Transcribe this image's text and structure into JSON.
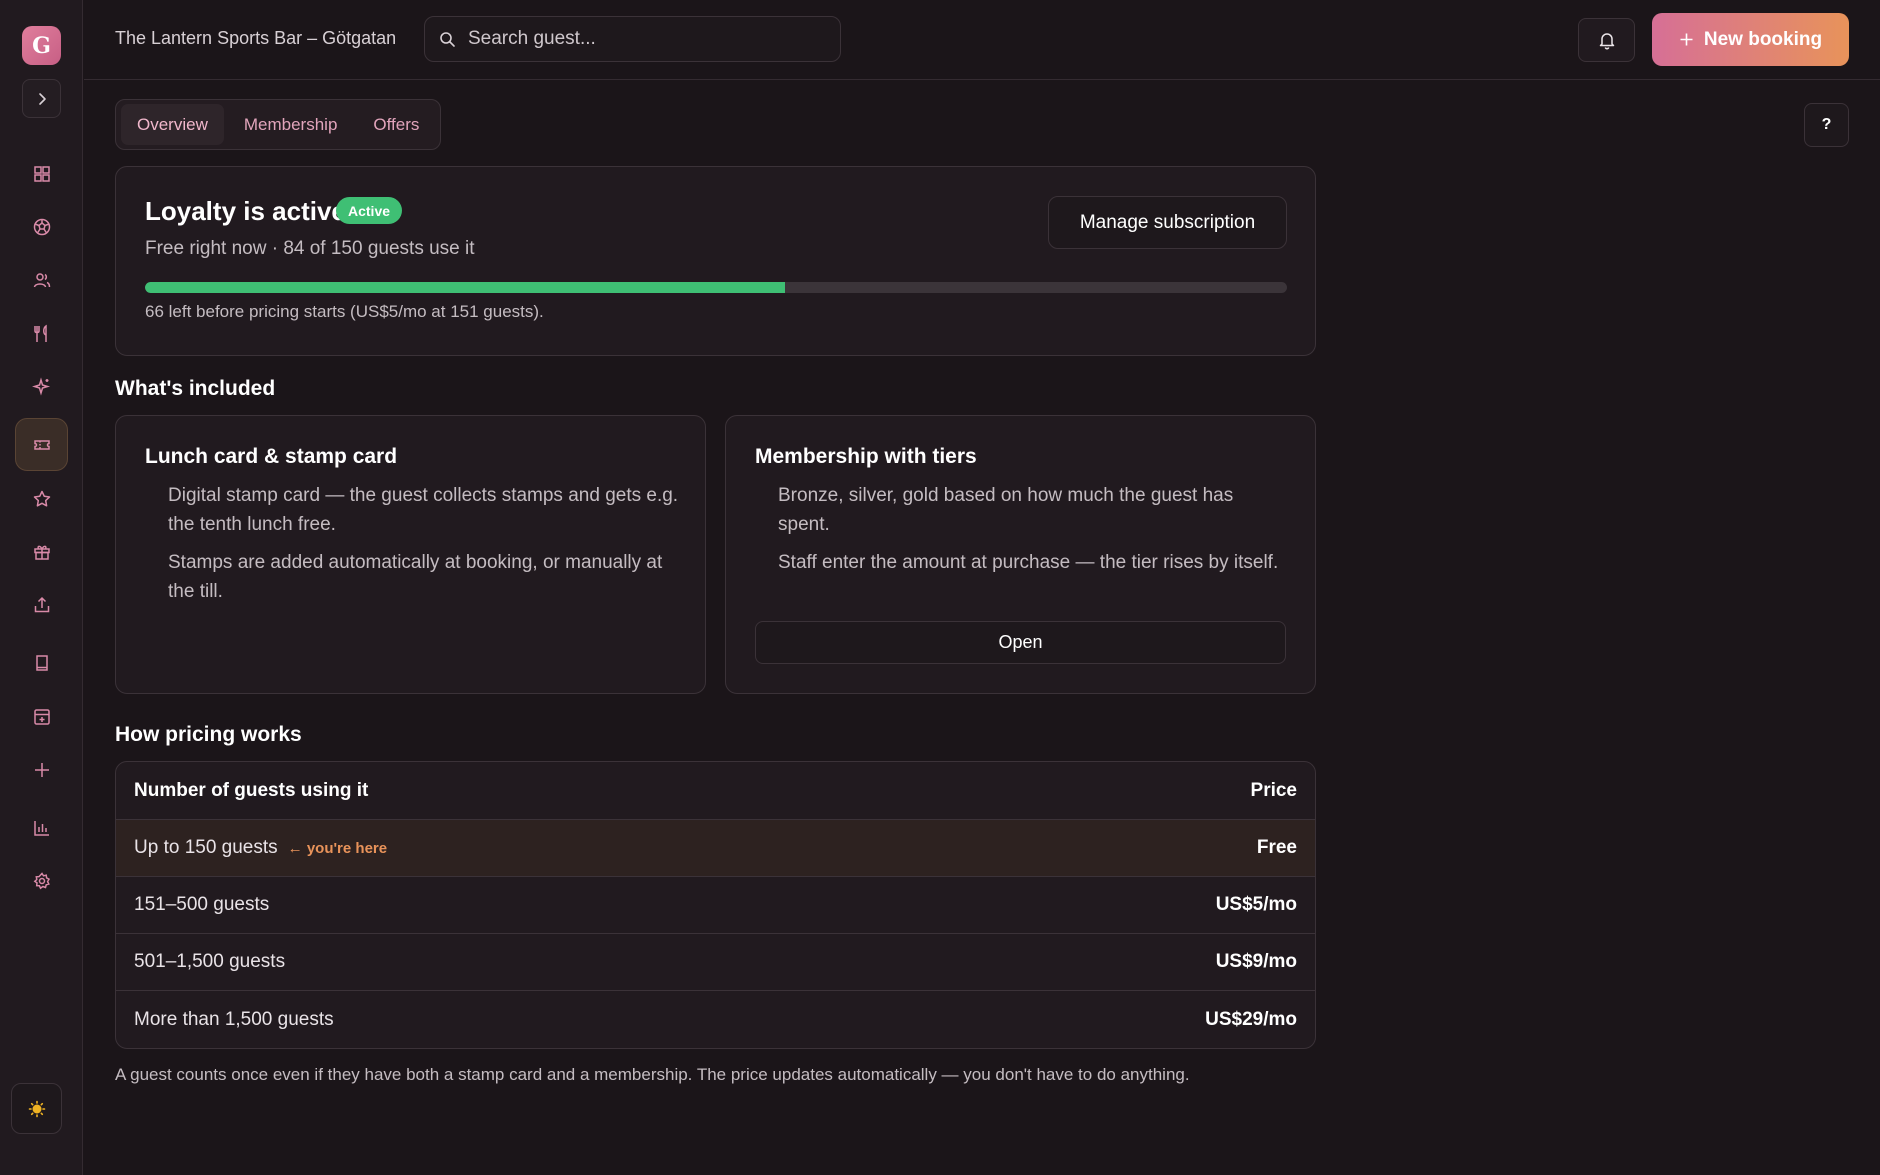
{
  "sidebar": {
    "logo_letter": "G",
    "icons": [
      "dashboard-icon",
      "soccer-ball-icon",
      "users-icon",
      "utensils-icon",
      "sparkles-icon",
      "ticket-icon",
      "star-icon",
      "gift-icon",
      "upload-icon",
      "book-icon",
      "calendar-plus-icon",
      "plus-icon",
      "bar-chart-icon",
      "settings-icon"
    ],
    "active": "ticket-icon",
    "theme_icon": "sun-icon"
  },
  "header": {
    "venue_name": "The Lantern Sports Bar – Götgatan",
    "search_placeholder": "Search guest...",
    "new_booking_label": "New booking"
  },
  "help_label": "?",
  "tabs": [
    {
      "label": "Overview",
      "active": true
    },
    {
      "label": "Membership",
      "active": false
    },
    {
      "label": "Offers",
      "active": false
    }
  ],
  "loyalty": {
    "title": "Loyalty is active",
    "badge": "Active",
    "subtitle": "Free right now · 84 of 150 guests use it",
    "manage_label": "Manage subscription",
    "progress_fraction": 0.56,
    "progress_note": "66 left before pricing starts (US$5/mo at 151 guests).",
    "accent_color": "#3fbf74"
  },
  "included": {
    "title": "What's included",
    "cards": [
      {
        "title": "Lunch card & stamp card",
        "points": [
          "Digital stamp card — the guest collects stamps and gets e.g. the tenth lunch free.",
          "Stamps are added automatically at booking, or manually at the till."
        ]
      },
      {
        "title": "Membership with tiers",
        "points": [
          "Bronze, silver, gold based on how much the guest has spent.",
          "Staff enter the amount at purchase — the tier rises by itself."
        ],
        "button": "Open"
      }
    ]
  },
  "pricing": {
    "title": "How pricing works",
    "header": {
      "label": "Number of guests using it",
      "price": "Price"
    },
    "rows": [
      {
        "label": "Up to 150 guests",
        "price": "Free",
        "marker": "← you're here"
      },
      {
        "label": "151–500 guests",
        "price": "US$5/mo"
      },
      {
        "label": "501–1,500 guests",
        "price": "US$9/mo"
      },
      {
        "label": "More than 1,500 guests",
        "price": "US$29/mo"
      }
    ],
    "footnote": "A guest counts once even if they have both a stamp card and a membership. The price updates automatically — you don't have to do anything."
  }
}
